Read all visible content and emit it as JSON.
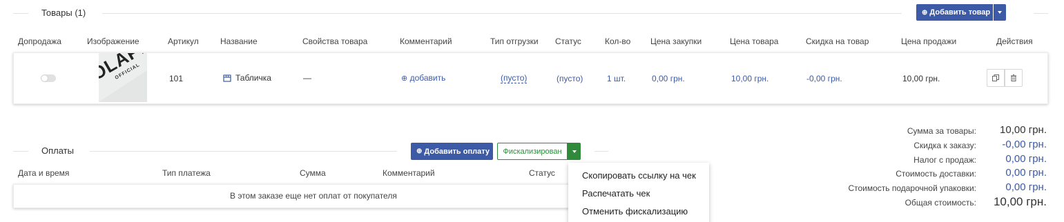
{
  "products": {
    "title": "Товары (1)",
    "add_button_label": "Добавить товар",
    "headers": {
      "presale": "Допродажа",
      "image": "Изображение",
      "sku": "Артикул",
      "name": "Название",
      "properties": "Свойства товара",
      "comment": "Комментарий",
      "shipment_type": "Тип отгрузки",
      "status": "Статус",
      "qty": "Кол-во",
      "purchase_price": "Цена закупки",
      "price": "Цена товара",
      "discount": "Скидка на товар",
      "sale_price": "Цена продажи",
      "actions": "Действия"
    },
    "row": {
      "sku": "101",
      "name": "Табличка",
      "properties": "—",
      "comment_link": "добавить",
      "shipment_type": "(пусто)",
      "status": "(пусто)",
      "qty": "1 шт.",
      "purchase_price": "0,00 грн.",
      "price": "10,00 грн.",
      "discount": "-0,00 грн.",
      "sale_price": "10,00 грн.",
      "image_text_1": "OLAPI",
      "image_text_2": "OFFICIAL"
    }
  },
  "payments": {
    "title": "Оплаты",
    "add_button_label": "Добавить оплату",
    "fiscal_button_label": "Фискализирован",
    "headers": {
      "datetime": "Дата и время",
      "type": "Тип платежа",
      "amount": "Сумма",
      "comment": "Комментарий",
      "status": "Статус"
    },
    "empty_text": "В этом заказе еще нет оплат от покупателя"
  },
  "fiscal_menu": {
    "items": [
      "Скопировать ссылку на чек",
      "Распечатать чек",
      "Отменить фискализацию"
    ]
  },
  "totals": {
    "items": [
      {
        "label": "Сумма за товары:",
        "value": "10,00 грн."
      },
      {
        "label": "Скидка к заказу:",
        "value": "-0,00 грн."
      },
      {
        "label": "Налог с продаж:",
        "value": "0,00 грн."
      },
      {
        "label": "Стоимость доставки:",
        "value": "0,00 грн."
      },
      {
        "label": "Стоимость подарочной упаковки:",
        "value": "0,00 грн."
      },
      {
        "label": "Общая стоимость:",
        "value": "10,00 грн."
      }
    ]
  },
  "colors": {
    "primary": "#3c5aa6",
    "link": "#3c5aa6",
    "success": "#2f8a3a"
  }
}
